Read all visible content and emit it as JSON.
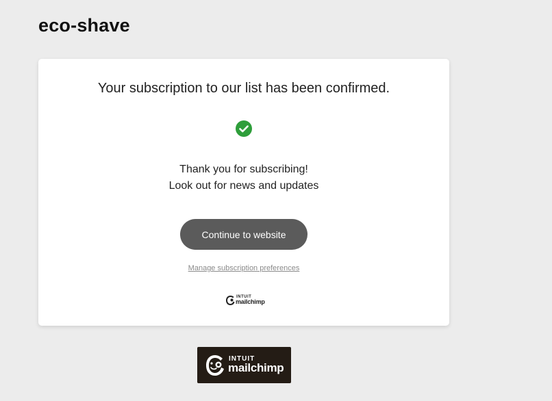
{
  "header": {
    "brand": "eco-shave"
  },
  "card": {
    "heading": "Your subscription to our list has been confirmed.",
    "status_icon": "check-circle-icon",
    "message_line1": "Thank you for subscribing!",
    "message_line2": "Look out for news and updates",
    "continue_label": "Continue to website",
    "manage_label": "Manage subscription preferences",
    "footer_logo": {
      "intuit": "INTUIT",
      "mailchimp": "mailchimp"
    }
  },
  "badge": {
    "intuit": "INTUIT",
    "mailchimp": "mailchimp"
  },
  "colors": {
    "page_background": "#ececec",
    "card_background": "#ffffff",
    "check_green": "#2e9e3a",
    "button_background": "#5b5b5b",
    "badge_background": "#241c15"
  }
}
